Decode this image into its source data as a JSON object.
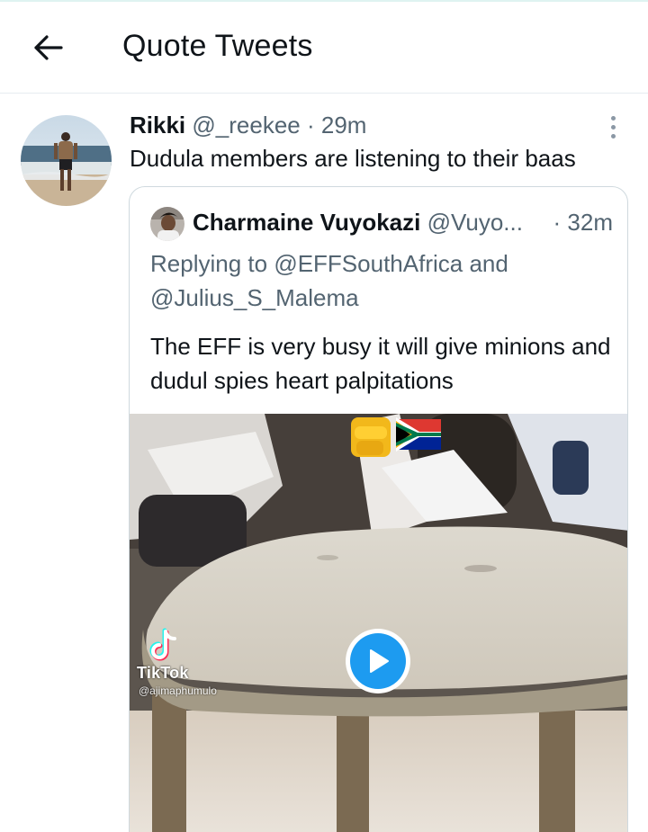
{
  "header": {
    "title": "Quote Tweets",
    "back_icon": "arrow-left-icon"
  },
  "tweet": {
    "name": "Rikki",
    "handle": "@_reekee",
    "separator": " · ",
    "time": "29m",
    "text": "Dudula members are listening to their baas",
    "more_icon": "more-vertical-icon"
  },
  "quote": {
    "name": "Charmaine Vuyokazi",
    "handle": "@Vuyo...",
    "time": "· 32m",
    "replying_prefix": "Replying to ",
    "reply_to_1": "@EFFSouthAfrica",
    "reply_and": " and ",
    "reply_to_2": "@Julius_S_Malema",
    "text": "The EFF is very busy it will give minions and dudul spies heart palpitations",
    "media": {
      "watermark_name": "TikTok",
      "watermark_handle": "@ajimaphumulo",
      "emoji": "✊",
      "play_icon": "play-icon"
    }
  },
  "colors": {
    "accent": "#1d9bf0",
    "muted": "#536471",
    "border": "#cfd9de"
  }
}
